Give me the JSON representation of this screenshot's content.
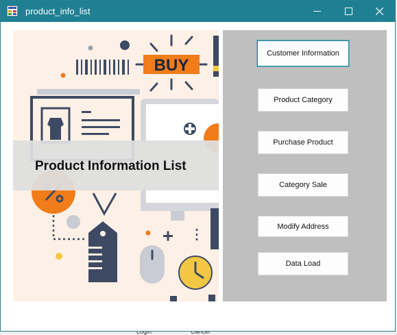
{
  "window": {
    "title": "product_info_list"
  },
  "banner": {
    "title": "Product Information List"
  },
  "illustration": {
    "buy_label": "BUY"
  },
  "buttons": {
    "customer_information": "Customer Information",
    "product_category": "Product Category",
    "purchase_product": "Purchase Product",
    "category_sale": "Category Sale",
    "modify_address": "Modify Address",
    "data_load": "Data Load"
  },
  "background_window": {
    "login_label": "Login",
    "cancel_label": "Cancel"
  },
  "colors": {
    "titlebar": "#1f7f93",
    "accent_orange": "#f07c1a",
    "navy": "#3e4a63",
    "panel_gray": "#bfbfbf"
  }
}
